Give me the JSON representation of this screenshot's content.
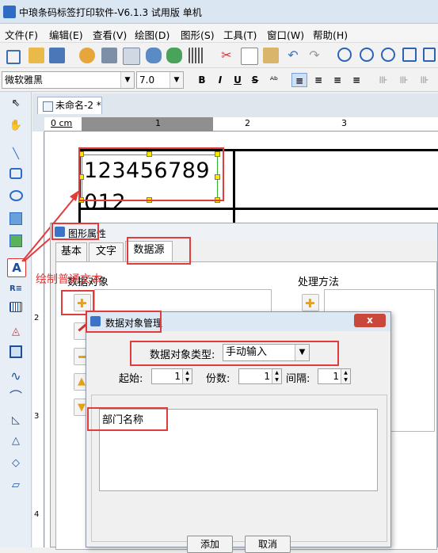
{
  "window": {
    "title": "中琅条码标签打印软件-V6.1.3 试用版 单机"
  },
  "menu": [
    "文件(F)",
    "编辑(E)",
    "查看(V)",
    "绘图(D)",
    "图形(S)",
    "工具(T)",
    "窗口(W)",
    "帮助(H)"
  ],
  "toolbar2": {
    "font": "微软雅黑",
    "size": "7.0",
    "bold": "B",
    "italic": "I",
    "underline": "U",
    "strike": "S"
  },
  "document": {
    "tab_title": "未命名-2 *",
    "ruler_unit": "0 cm",
    "ruler_marks": [
      "1",
      "2",
      "3"
    ],
    "v_ruler_marks": [
      "2",
      "3",
      "4"
    ],
    "text_line1": "123456789",
    "text_line2": "012"
  },
  "annotation": {
    "label": "绘制普通文本",
    "color": "#e23b3b"
  },
  "shape_dialog": {
    "title": "图形属性",
    "tabs": [
      "基本",
      "文字",
      "数据源"
    ],
    "data_object_label": "数据对象",
    "process_label": "处理方法"
  },
  "data_object_dialog": {
    "title": "数据对象管理",
    "type_label": "数据对象类型:",
    "type_value": "手动输入",
    "start_label": "起始:",
    "start_value": "1",
    "copies_label": "份数:",
    "copies_value": "1",
    "interval_label": "间隔:",
    "interval_value": "1",
    "text_value": "部门名称",
    "add_button": "添加",
    "cancel_button": "取消",
    "close_glyph": "x"
  }
}
